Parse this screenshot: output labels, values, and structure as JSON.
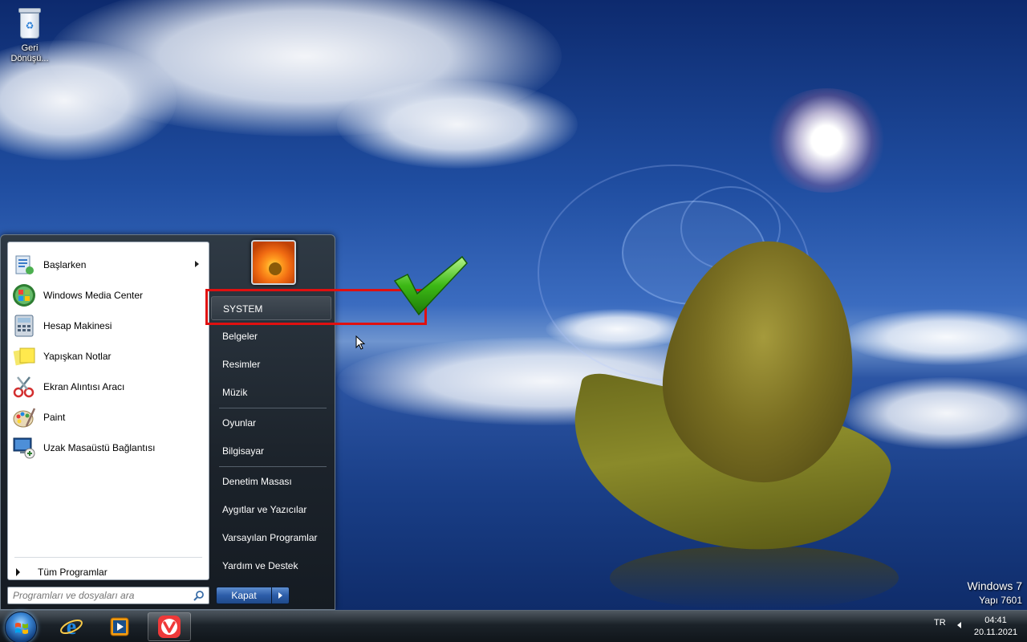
{
  "desktop": {
    "icons": [
      {
        "label": "Geri Dönüşü...",
        "icon": "recycle-bin-icon"
      }
    ]
  },
  "start_menu": {
    "programs": [
      {
        "label": "Başlarken",
        "icon": "getting-started-icon",
        "has_submenu": true
      },
      {
        "label": "Windows Media Center",
        "icon": "media-center-icon"
      },
      {
        "label": "Hesap Makinesi",
        "icon": "calculator-icon"
      },
      {
        "label": "Yapışkan Notlar",
        "icon": "sticky-notes-icon"
      },
      {
        "label": "Ekran Alıntısı Aracı",
        "icon": "snipping-tool-icon"
      },
      {
        "label": "Paint",
        "icon": "paint-icon"
      },
      {
        "label": "Uzak Masaüstü Bağlantısı",
        "icon": "remote-desktop-icon"
      }
    ],
    "all_programs": "Tüm Programlar",
    "search_placeholder": "Programları ve dosyaları ara",
    "right_items": [
      "SYSTEM",
      "Belgeler",
      "Resimler",
      "Müzik",
      "Oyunlar",
      "Bilgisayar",
      "Denetim Masası",
      "Aygıtlar ve Yazıcılar",
      "Varsayılan Programlar",
      "Yardım ve Destek"
    ],
    "highlighted_item": "SYSTEM",
    "shutdown_label": "Kapat"
  },
  "watermark": {
    "line1": "Windows 7",
    "line2": "Yapı 7601"
  },
  "taskbar": {
    "pinned": [
      {
        "name": "internet-explorer",
        "icon": "internet-explorer-icon"
      },
      {
        "name": "media-player",
        "icon": "media-player-icon"
      },
      {
        "name": "vivaldi",
        "icon": "vivaldi-icon",
        "active": true
      }
    ],
    "language": "TR",
    "time": "04:41",
    "date": "20.11.2021"
  },
  "colors": {
    "annotation_red": "#e01010",
    "check_green": "#3cb815",
    "orb_blue": "#3a86d4"
  }
}
